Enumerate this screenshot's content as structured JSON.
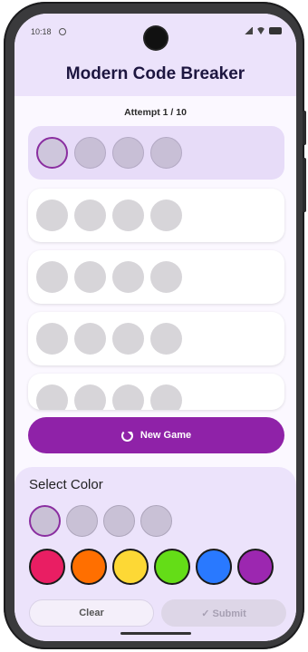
{
  "status": {
    "time": "10:18"
  },
  "header": {
    "title": "Modern Code Breaker"
  },
  "game": {
    "attempt_text": "Attempt 1 / 10"
  },
  "new_game": {
    "label": "New Game",
    "icon": "refresh-icon"
  },
  "select_panel": {
    "title": "Select Color",
    "palette_colors": [
      "#e91e63",
      "#ff6f00",
      "#fdd835",
      "#64dd17",
      "#2979ff",
      "#9c27b0"
    ],
    "clear_label": "Clear",
    "submit_label": "✓ Submit"
  }
}
